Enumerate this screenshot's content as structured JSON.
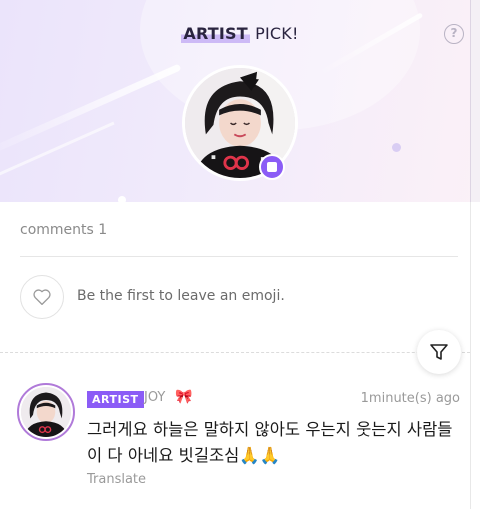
{
  "header": {
    "title_highlight": "ARTIST",
    "title_rest": " PICK!",
    "help_icon": "question-circle-icon",
    "accent_color": "#8b5cf6"
  },
  "comments": {
    "count_label": "comments 1"
  },
  "emoji": {
    "prompt": "Be the first to leave an emoji.",
    "icon": "heart-outline-icon"
  },
  "filter": {
    "icon": "filter-funnel-icon"
  },
  "comment": {
    "badge": "ARTIST",
    "author": "JOY",
    "decoration": "🎀",
    "time": "1minute(s) ago",
    "text": "그러게요 하늘은 말하지 않아도 우는지 웃는지 사람들이 다 아네요 빗길조심🙏🙏",
    "translate_label": "Translate"
  }
}
